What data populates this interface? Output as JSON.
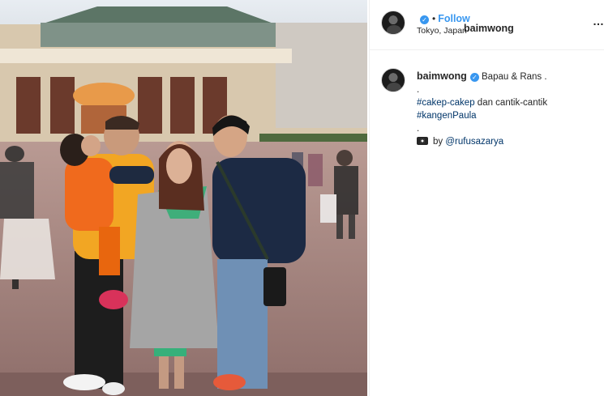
{
  "post": {
    "username": "baimwong",
    "follow_label": "Follow",
    "location": "Tokyo, Japan",
    "more_label": "…"
  },
  "caption": {
    "username": "baimwong",
    "line1": "Bapau & Rans .",
    "line2": ".",
    "hashtag1": "#cakep-cakep",
    "line3_rest": " dan cantik-cantik",
    "hashtag2": "#kangenPaula",
    "line5": ".",
    "credit_prefix": "by",
    "credit_mention": "@rufusazarya"
  },
  "icons": {
    "verified": "verified-badge-icon",
    "more": "more-options-icon",
    "camera": "camera-icon"
  },
  "colors": {
    "link": "#3897f0",
    "hashtag": "#003569"
  }
}
